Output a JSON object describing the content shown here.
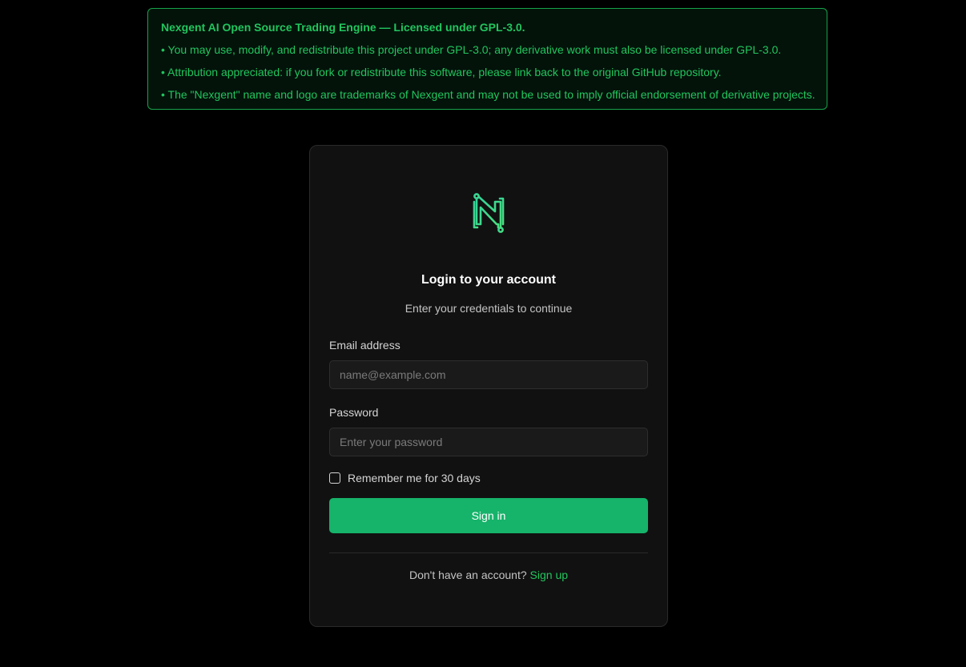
{
  "license": {
    "title": "Nexgent AI Open Source Trading Engine — Licensed under GPL-3.0.",
    "lines": [
      "• You may use, modify, and redistribute this project under GPL-3.0; any derivative work must also be licensed under GPL-3.0.",
      "• Attribution appreciated: if you fork or redistribute this software, please link back to the original GitHub repository.",
      "• The \"Nexgent\" name and logo are trademarks of Nexgent and may not be used to imply official endorsement of derivative projects."
    ]
  },
  "login": {
    "logo_icon": "nexgent-logo-icon",
    "title": "Login to your account",
    "subtitle": "Enter your credentials to continue",
    "email_label": "Email address",
    "email_placeholder": "name@example.com",
    "email_value": "",
    "password_label": "Password",
    "password_placeholder": "Enter your password",
    "password_value": "",
    "remember_label": "Remember me for 30 days",
    "remember_checked": false,
    "sign_in_label": "Sign in",
    "signup_prompt": "Don't have an account?",
    "signup_link": "Sign up"
  },
  "colors": {
    "accent": "#16b36a",
    "accent_text": "#22c55e",
    "background": "#000000",
    "card": "#111111"
  }
}
